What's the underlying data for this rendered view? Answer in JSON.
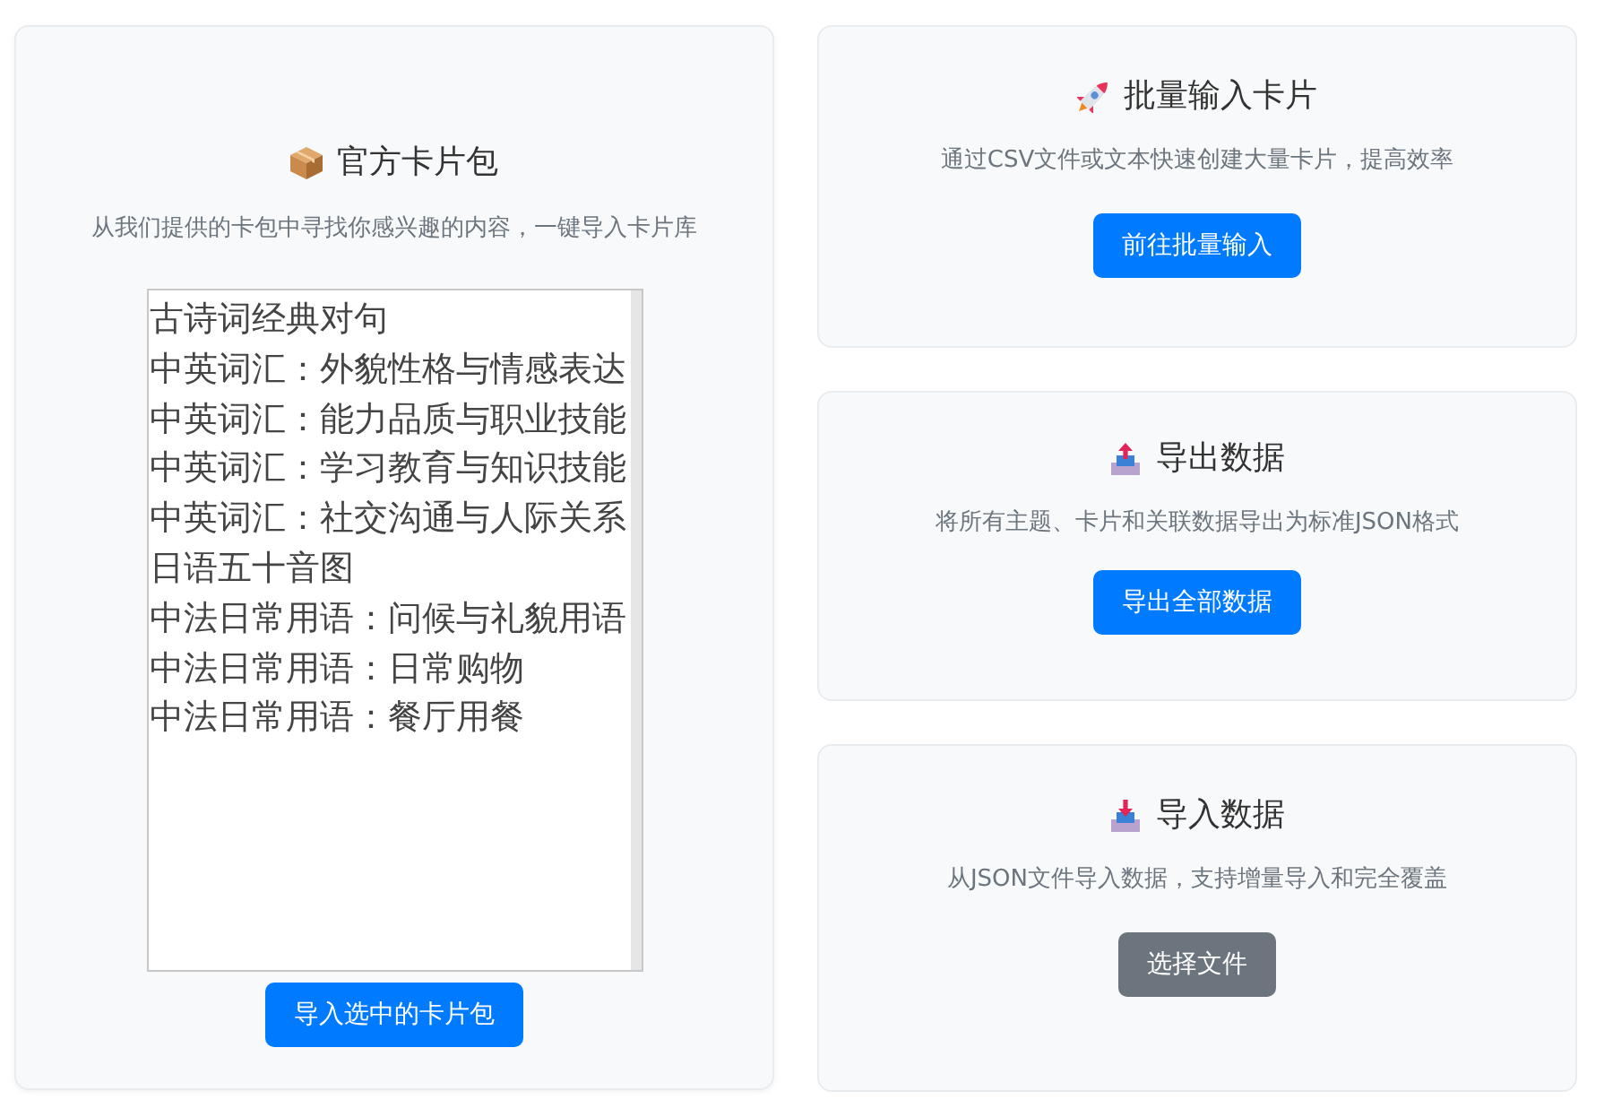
{
  "official_pack": {
    "title": "官方卡片包",
    "description": "从我们提供的卡包中寻找你感兴趣的内容，一键导入卡片库",
    "packs": [
      {
        "label": "古诗词经典对句",
        "selected": false
      },
      {
        "label": "中英词汇：外貌性格与情感表达",
        "selected": false
      },
      {
        "label": "中英词汇：能力品质与职业技能",
        "selected": false
      },
      {
        "label": "中英词汇：学习教育与知识技能",
        "selected": false
      },
      {
        "label": "中英词汇：社交沟通与人际关系",
        "selected": false
      },
      {
        "label": "日语五十音图",
        "selected": false
      },
      {
        "label": "中法日常用语：问候与礼貌用语",
        "selected": false
      },
      {
        "label": "中法日常用语：日常购物",
        "selected": false
      },
      {
        "label": "中法日常用语：餐厅用餐",
        "selected": false
      }
    ],
    "button": "导入选中的卡片包"
  },
  "actions": [
    {
      "kind": "bulk_input",
      "title": "批量输入卡片",
      "description": "通过CSV文件或文本快速创建大量卡片，提高效率",
      "button": "前往批量输入"
    },
    {
      "kind": "export",
      "title": "导出数据",
      "description": "将所有主题、卡片和关联数据导出为标准JSON格式",
      "button": "导出全部数据"
    },
    {
      "kind": "import",
      "title": "导入数据",
      "description": "从JSON文件导入数据，支持增量导入和完全覆盖",
      "button": "选择文件"
    }
  ]
}
